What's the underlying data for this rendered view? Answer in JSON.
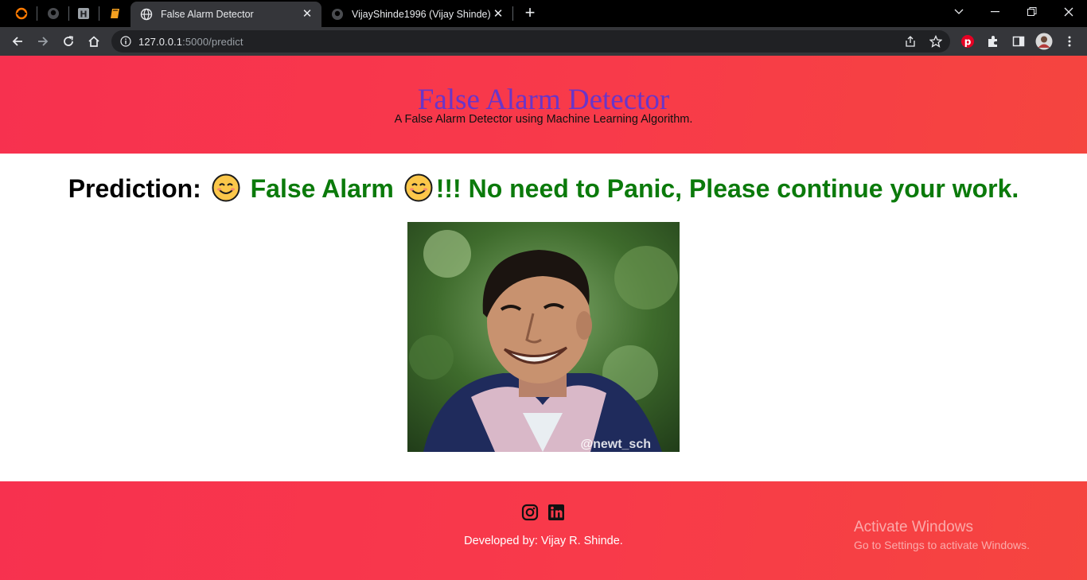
{
  "browser": {
    "tabs": [
      {
        "title": "False Alarm Detector",
        "active": true,
        "favicon": "globe-icon"
      },
      {
        "title": "VijayShinde1996 (Vijay Shinde)",
        "active": false,
        "favicon": "github-icon"
      }
    ],
    "close_label": "✕",
    "newtab_label": "+",
    "url": {
      "host": "127.0.0.1",
      "rest": ":5000/predict"
    }
  },
  "page": {
    "title": "False Alarm Detector",
    "subtitle": "A False Alarm Detector using Machine Learning Algorithm.",
    "prediction": {
      "label": "Prediction:",
      "result": "False Alarm",
      "suffix": "!!! No need to Panic, Please continue your work."
    },
    "image_watermark": "@newt_sch",
    "credit": "Developed by: Vijay R. Shinde.",
    "social": [
      "instagram-icon",
      "linkedin-icon"
    ]
  },
  "os_overlay": {
    "line1": "Activate Windows",
    "line2": "Go to Settings to activate Windows."
  },
  "colors": {
    "header_gradient": "#f7314f",
    "title": "#6a35c8",
    "success": "#0b7a0b"
  }
}
